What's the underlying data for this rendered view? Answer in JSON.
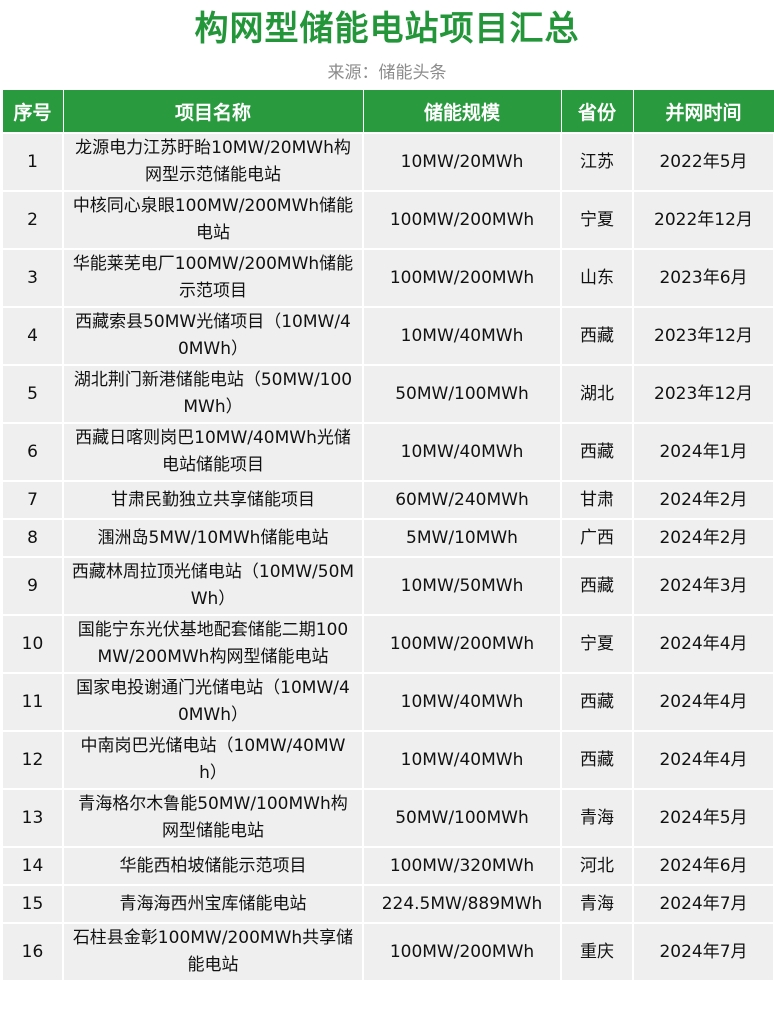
{
  "header": {
    "title": "构网型储能电站项目汇总",
    "source": "来源：储能头条"
  },
  "table": {
    "columns": [
      "序号",
      "项目名称",
      "储能规模",
      "省份",
      "并网时间"
    ],
    "rows": [
      {
        "no": "1",
        "name": "龙源电力江苏盱眙10MW/20MWh构网型示范储能电站",
        "scale": "10MW/20MWh",
        "province": "江苏",
        "date": "2022年5月",
        "tall": true
      },
      {
        "no": "2",
        "name": "中核同心泉眼100MW/200MWh储能电站",
        "scale": "100MW/200MWh",
        "province": "宁夏",
        "date": "2022年12月",
        "tall": true
      },
      {
        "no": "3",
        "name": "华能莱芜电厂100MW/200MWh储能示范项目",
        "scale": "100MW/200MWh",
        "province": "山东",
        "date": "2023年6月",
        "tall": true
      },
      {
        "no": "4",
        "name": "西藏索县50MW光储项目（10MW/40MWh）",
        "scale": "10MW/40MWh",
        "province": "西藏",
        "date": "2023年12月",
        "tall": true
      },
      {
        "no": "5",
        "name": "湖北荆门新港储能电站（50MW/100MWh）",
        "scale": "50MW/100MWh",
        "province": "湖北",
        "date": "2023年12月",
        "tall": true
      },
      {
        "no": "6",
        "name": "西藏日喀则岗巴10MW/40MWh光储电站储能项目",
        "scale": "10MW/40MWh",
        "province": "西藏",
        "date": "2024年1月",
        "tall": true
      },
      {
        "no": "7",
        "name": "甘肃民勤独立共享储能项目",
        "scale": "60MW/240MWh",
        "province": "甘肃",
        "date": "2024年2月",
        "tall": false
      },
      {
        "no": "8",
        "name": "涠洲岛5MW/10MWh储能电站",
        "scale": "5MW/10MWh",
        "province": "广西",
        "date": "2024年2月",
        "tall": false
      },
      {
        "no": "9",
        "name": "西藏林周拉顶光储电站（10MW/50MWh）",
        "scale": "10MW/50MWh",
        "province": "西藏",
        "date": "2024年3月",
        "tall": true
      },
      {
        "no": "10",
        "name": "国能宁东光伏基地配套储能二期100MW/200MWh构网型储能电站",
        "scale": "100MW/200MWh",
        "province": "宁夏",
        "date": "2024年4月",
        "tall": true
      },
      {
        "no": "11",
        "name": "国家电投谢通门光储电站（10MW/40MWh）",
        "scale": "10MW/40MWh",
        "province": "西藏",
        "date": "2024年4月",
        "tall": true
      },
      {
        "no": "12",
        "name": "中南岗巴光储电站（10MW/40MWh）",
        "scale": "10MW/40MWh",
        "province": "西藏",
        "date": "2024年4月",
        "tall": true
      },
      {
        "no": "13",
        "name": "青海格尔木鲁能50MW/100MWh构网型储能电站",
        "scale": "50MW/100MWh",
        "province": "青海",
        "date": "2024年5月",
        "tall": true
      },
      {
        "no": "14",
        "name": "华能西柏坡储能示范项目",
        "scale": "100MW/320MWh",
        "province": "河北",
        "date": "2024年6月",
        "tall": false
      },
      {
        "no": "15",
        "name": "青海海西州宝库储能电站",
        "scale": "224.5MW/889MWh",
        "province": "青海",
        "date": "2024年7月",
        "tall": false
      },
      {
        "no": "16",
        "name": "石柱县金彰100MW/200MWh共享储能电站",
        "scale": "100MW/200MWh",
        "province": "重庆",
        "date": "2024年7月",
        "tall": true
      }
    ]
  }
}
